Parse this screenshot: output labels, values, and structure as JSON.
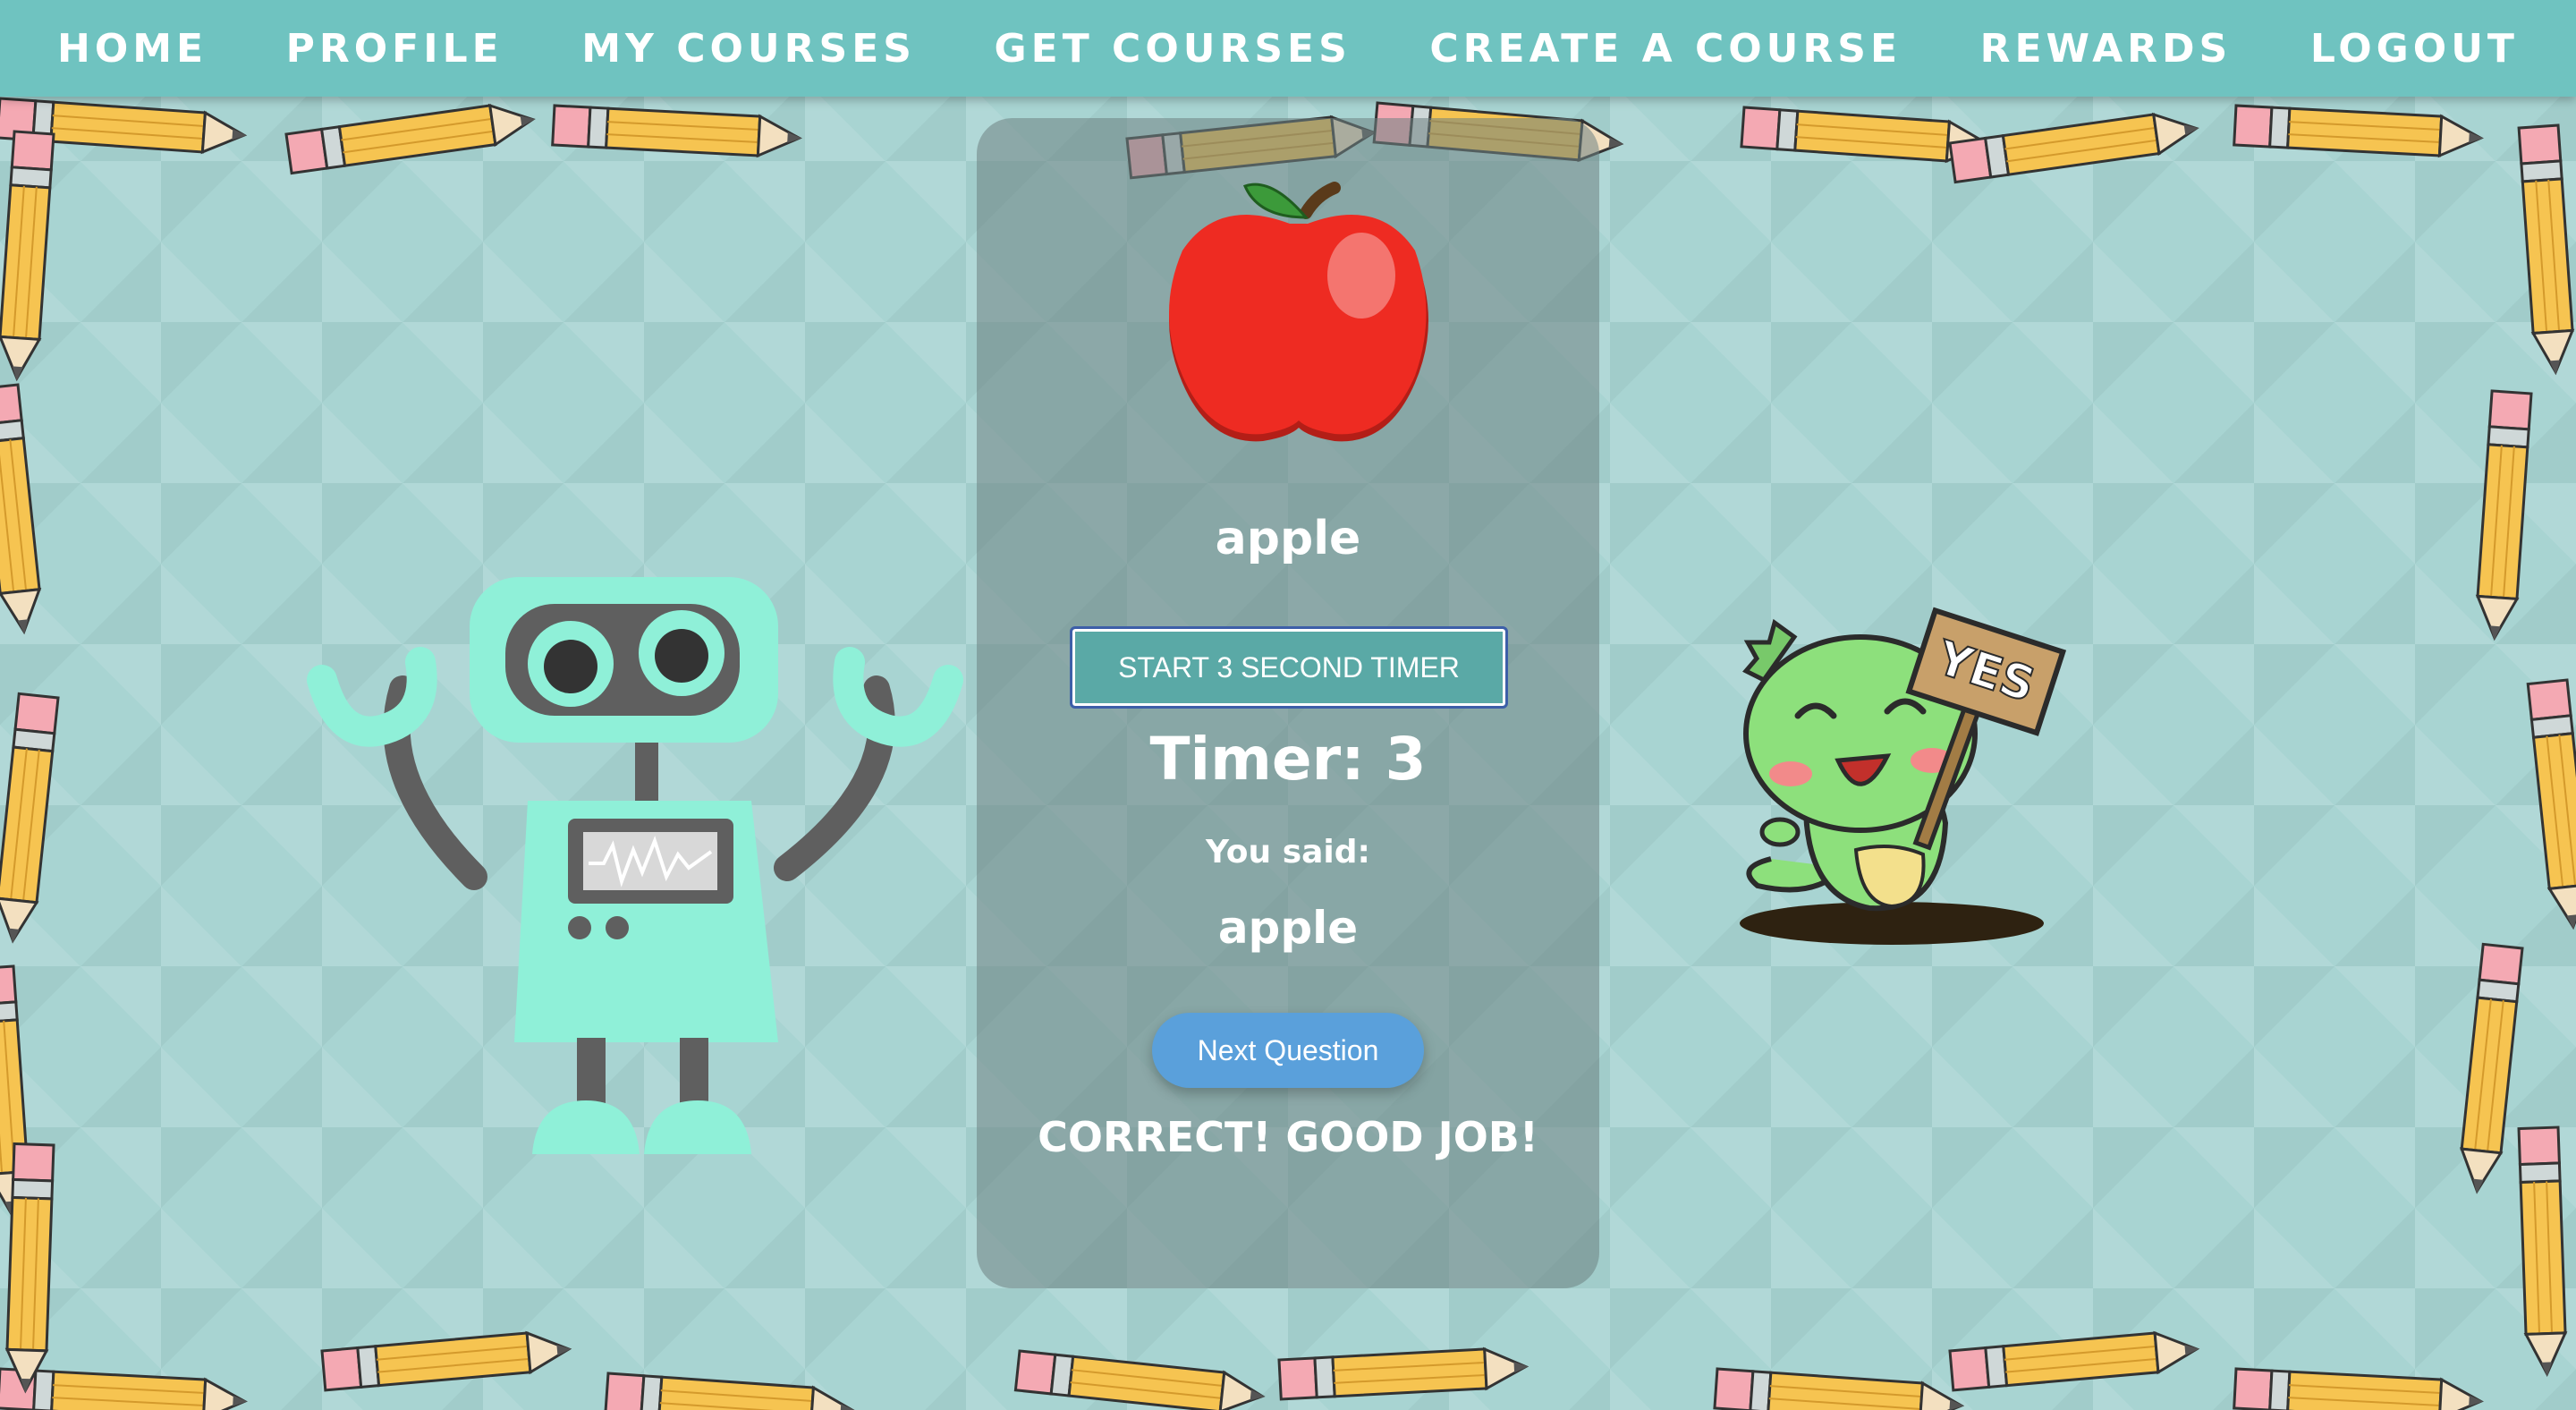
{
  "nav": {
    "items": [
      {
        "label": "HOME"
      },
      {
        "label": "PROFILE"
      },
      {
        "label": "MY COURSES"
      },
      {
        "label": "GET COURSES"
      },
      {
        "label": "CREATE A COURSE"
      },
      {
        "label": "REWARDS"
      },
      {
        "label": "LOGOUT"
      }
    ]
  },
  "quiz": {
    "image_icon": "apple-icon",
    "word": "apple",
    "timer_button_label": "START 3 SECOND TIMER",
    "timer_text": "Timer: 3",
    "you_said_label": "You said:",
    "spoken_answer": "apple",
    "next_button_label": "Next Question",
    "feedback": "CORRECT! GOOD JOB!"
  },
  "sign": {
    "text": "YES"
  },
  "colors": {
    "nav_bg": "#6fc3c0",
    "page_bg": "#a8d4d2",
    "timer_button": "#5aa9a6",
    "next_button": "#5aa0db",
    "robot": "#8ff0d8",
    "dino": "#8de07c",
    "apple": "#ee2b22"
  },
  "decor": [
    "robot-illustration",
    "dinosaur-yes-sign-illustration",
    "pencil-border"
  ]
}
